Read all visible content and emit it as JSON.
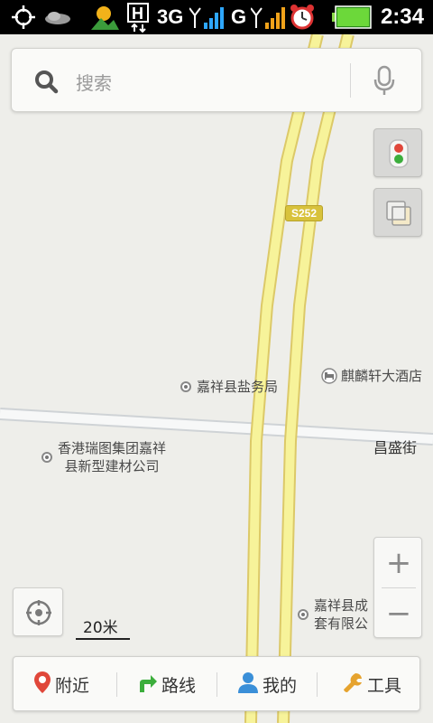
{
  "status_bar": {
    "network_1": "3G",
    "network_2": "G",
    "time": "2:34"
  },
  "search": {
    "placeholder": "搜索",
    "icon": "search-icon",
    "voice_icon": "microphone-icon"
  },
  "map": {
    "road_shield": "S252",
    "street_label": "昌盛街",
    "pois": [
      {
        "label": "嘉祥县盐务局"
      },
      {
        "label": "麒麟轩大酒店"
      },
      {
        "label_line1": "香港瑞图集团嘉祥",
        "label_line2": "县新型建材公司"
      },
      {
        "label_line1": "嘉祥县成",
        "label_line2": "套有限公"
      }
    ],
    "scale_label": "20米"
  },
  "controls": {
    "traffic_icon": "traffic-light-icon",
    "layers_icon": "layers-icon",
    "zoom_in": "+",
    "zoom_out": "−",
    "locate_icon": "locate-icon"
  },
  "bottom_bar": {
    "tabs": [
      {
        "label": "附近",
        "icon": "location-pin-icon"
      },
      {
        "label": "路线",
        "icon": "route-arrow-icon"
      },
      {
        "label": "我的",
        "icon": "person-icon"
      },
      {
        "label": "工具",
        "icon": "wrench-icon"
      }
    ]
  },
  "colors": {
    "road_fill": "#f7f39a",
    "road_outline": "#dcc968",
    "accent_red": "#e0473a",
    "accent_green": "#3cae3c",
    "accent_blue": "#3a8fd8",
    "accent_orange": "#e6a32e"
  }
}
